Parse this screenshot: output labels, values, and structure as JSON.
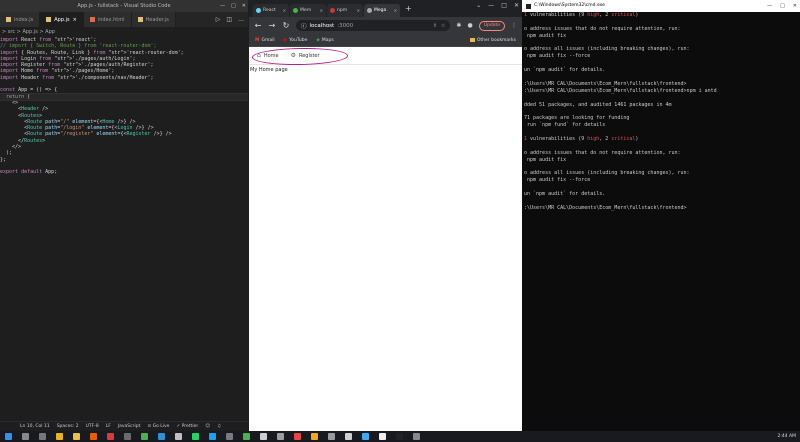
{
  "vscode": {
    "title": "App.js - fullstack - Visual Studio Code",
    "tabs": [
      {
        "label": "index.js",
        "icon": "js-file-icon"
      },
      {
        "label": "App.js",
        "icon": "js-file-icon",
        "active": true,
        "close": "×"
      },
      {
        "label": "index.html",
        "icon": "html-file-icon"
      },
      {
        "label": "Header.js",
        "icon": "js-file-icon"
      }
    ],
    "breadcrumb": "> src > App.js > App",
    "code": [
      "import React from 'react';",
      "// import { Switch, Route } from 'react-router-dom';",
      "import { Routes, Route, Link } from 'react-router-dom';",
      "import Login from './pages/auth/Login';",
      "import Register from './pages/auth/Register';",
      "import Home from './pages/Home';",
      "import Header from './components/nav/Header';",
      "",
      "const App = () => {",
      "  return (",
      "    <>",
      "      <Header />",
      "      <Routes>",
      "        <Route path=\"/\" element={<Home />} />",
      "        <Route path=\"/login\" element={<Login />} />",
      "        <Route path=\"/register\" element={<Register />} />",
      "      </Routes>",
      "    </>",
      "  );",
      "};",
      "",
      "export default App;"
    ],
    "highlighted_line": 9,
    "status": {
      "position": "Ln 10, Col 11",
      "spaces": "Spaces: 2",
      "encoding": "UTF-8",
      "eol": "LF",
      "language": "JavaScript",
      "golive": "Go Live",
      "prettier": "Prettier"
    }
  },
  "browser": {
    "tabs": [
      {
        "label": "React"
      },
      {
        "label": "Mern"
      },
      {
        "label": "npm"
      },
      {
        "label": "Mega",
        "active": true
      }
    ],
    "url_host": "localhost",
    "url_port": ":3000",
    "update_label": "Update",
    "bookmarks": [
      {
        "label": "Gmail",
        "icon": "gmail-icon"
      },
      {
        "label": "YouTube",
        "icon": "youtube-icon"
      },
      {
        "label": "Maps",
        "icon": "maps-icon"
      }
    ],
    "other_bookmarks": "Other bookmarks",
    "site_nav": [
      {
        "label": "Home",
        "icon": "home-icon"
      },
      {
        "label": "Register",
        "icon": "settings-icon"
      }
    ],
    "page_text": "My Home page"
  },
  "terminal": {
    "title": "C:\\Windows\\System32\\cmd.exe",
    "lines": [
      {
        "pre": "1 vulnerabilities (9 ",
        "high": "high",
        "mid": ", 2 ",
        "crit": "critical",
        "post": ")"
      },
      {
        "text": ""
      },
      {
        "text": "o address issues that do not require attention, run:"
      },
      {
        "text": " npm audit fix"
      },
      {
        "text": ""
      },
      {
        "text": "o address all issues (including breaking changes), run:"
      },
      {
        "text": " npm audit fix --force"
      },
      {
        "text": ""
      },
      {
        "text": "un `npm audit` for details."
      },
      {
        "text": ""
      },
      {
        "text": ":\\Users\\MR CAL\\Documents\\Ecom_Mern\\fullstack\\frontend>"
      },
      {
        "text": ":\\Users\\MR CAL\\Documents\\Ecom_Mern\\fullstack\\frontend>npm i antd"
      },
      {
        "text": ""
      },
      {
        "text": "dded 51 packages, and audited 1461 packages in 4m"
      },
      {
        "text": ""
      },
      {
        "text": "71 packages are looking for funding"
      },
      {
        "text": " run `npm fund` for details"
      },
      {
        "text": ""
      },
      {
        "pre": "1 vulnerabilities (9 ",
        "high": "high",
        "mid": ", 2 ",
        "crit": "critical",
        "post": ")"
      },
      {
        "text": ""
      },
      {
        "text": "o address issues that do not require attention, run:"
      },
      {
        "text": " npm audit fix"
      },
      {
        "text": ""
      },
      {
        "text": "o address all issues (including breaking changes), run:"
      },
      {
        "text": " npm audit fix --force"
      },
      {
        "text": ""
      },
      {
        "text": "un `npm audit` for details."
      },
      {
        "text": ""
      },
      {
        "text": ":\\Users\\MR CAL\\Documents\\Ecom_Mern\\fullstack\\frontend>"
      }
    ]
  },
  "taskbar": {
    "time": "2:44 AM",
    "apps": [
      {
        "icon": "windows-start-icon",
        "color": "#3a8ee6"
      },
      {
        "icon": "search-icon",
        "color": "#888888"
      },
      {
        "icon": "task-view-icon",
        "color": "#777777"
      },
      {
        "icon": "chrome-icon",
        "color": "#e6b422"
      },
      {
        "icon": "file-explorer-icon",
        "color": "#e8c14a"
      },
      {
        "icon": "firefox-icon",
        "color": "#e66000"
      },
      {
        "icon": "app-icon",
        "color": "#d83b3b"
      },
      {
        "icon": "app-icon",
        "color": "#6b6b6b"
      },
      {
        "icon": "chrome-icon",
        "color": "#4caf50"
      },
      {
        "icon": "vscode-icon",
        "color": "#2d8fd6"
      },
      {
        "icon": "app-icon",
        "color": "#c0c0c0"
      },
      {
        "icon": "app-icon",
        "color": "#25d366"
      },
      {
        "icon": "app-icon",
        "color": "#1da1f2"
      },
      {
        "icon": "app-icon",
        "color": "#7a7a7a"
      },
      {
        "icon": "app-icon",
        "color": "#4caf50"
      },
      {
        "icon": "app-icon",
        "color": "#cfcfcf"
      },
      {
        "icon": "app-icon",
        "color": "#9e9e9e"
      },
      {
        "icon": "app-icon",
        "color": "#e84545"
      },
      {
        "icon": "app-icon",
        "color": "#f5a623"
      },
      {
        "icon": "app-icon",
        "color": "#9a9a9a"
      },
      {
        "icon": "app-icon",
        "color": "#d0d0d0"
      },
      {
        "icon": "app-icon",
        "color": "#3fa9f5"
      },
      {
        "icon": "app-icon",
        "color": "#eeeeee"
      },
      {
        "icon": "app-icon",
        "color": "#222222"
      },
      {
        "icon": "app-icon",
        "color": "#888888"
      }
    ]
  },
  "colors": {
    "annotation": "#b0228c",
    "term_red": "#e74856",
    "update": "#f28b82"
  }
}
